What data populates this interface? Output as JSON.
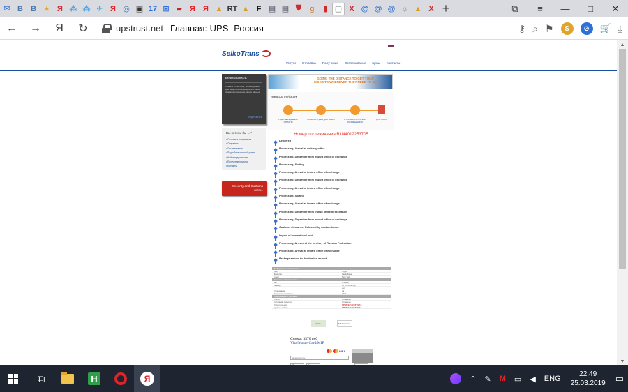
{
  "browser": {
    "tabs": [
      {
        "icon": "mail-icon",
        "glyph": "✉",
        "color": "#2f6fd6"
      },
      {
        "icon": "vk-icon",
        "glyph": "В",
        "color": "#4a76a8"
      },
      {
        "icon": "vk-icon",
        "glyph": "В",
        "color": "#4a76a8"
      },
      {
        "icon": "star-icon",
        "glyph": "★",
        "color": "#e8a628"
      },
      {
        "icon": "yandex-icon",
        "glyph": "Я",
        "color": "#e0222a"
      },
      {
        "icon": "dots-icon",
        "glyph": "⁂",
        "color": "#3c9be0"
      },
      {
        "icon": "dots-icon",
        "glyph": "⁂",
        "color": "#3c9be0"
      },
      {
        "icon": "plane-icon",
        "glyph": "✈",
        "color": "#3c9be0"
      },
      {
        "icon": "yandex-icon",
        "glyph": "Я",
        "color": "#e0222a"
      },
      {
        "icon": "search-icon",
        "glyph": "◎",
        "color": "#3c78c8"
      },
      {
        "icon": "image-icon",
        "glyph": "▣",
        "color": "#333"
      },
      {
        "icon": "calendar-icon",
        "glyph": "17",
        "color": "#2f6fd6"
      },
      {
        "icon": "windows-icon",
        "glyph": "⊞",
        "color": "#2f6fd6"
      },
      {
        "icon": "car-icon",
        "glyph": "▰",
        "color": "#c02828"
      },
      {
        "icon": "yandex-icon",
        "glyph": "Я",
        "color": "#e0222a"
      },
      {
        "icon": "yandex-icon",
        "glyph": "Я",
        "color": "#e0222a"
      },
      {
        "icon": "photo-icon",
        "glyph": "▲",
        "color": "#d9a020"
      },
      {
        "icon": "rt-icon",
        "glyph": "RT",
        "color": "#333"
      },
      {
        "icon": "photo-icon",
        "glyph": "▲",
        "color": "#d9a020"
      },
      {
        "icon": "f-icon",
        "glyph": "F",
        "color": "#111"
      },
      {
        "icon": "doc-icon",
        "glyph": "▤",
        "color": "#556"
      },
      {
        "icon": "doc-icon",
        "glyph": "▤",
        "color": "#556"
      },
      {
        "icon": "shield-icon",
        "glyph": "⛊",
        "color": "#d02a2a"
      },
      {
        "icon": "g-icon",
        "glyph": "g",
        "color": "#d07020"
      },
      {
        "icon": "bookmark-icon",
        "glyph": "▮",
        "color": "#d02a2a"
      },
      {
        "icon": "page-icon",
        "glyph": "▢",
        "color": "#777"
      },
      {
        "icon": "x-icon",
        "glyph": "X",
        "color": "#d02a2a"
      },
      {
        "icon": "mail-at-icon",
        "glyph": "@",
        "color": "#2f6fd6"
      },
      {
        "icon": "mail-at-icon",
        "glyph": "@",
        "color": "#2f6fd6"
      },
      {
        "icon": "mail-at-icon",
        "glyph": "@",
        "color": "#2f6fd6"
      },
      {
        "icon": "sun-icon",
        "glyph": "☼",
        "color": "#777"
      },
      {
        "icon": "photo-icon",
        "glyph": "▲",
        "color": "#d9a020"
      },
      {
        "icon": "x-icon",
        "glyph": "X",
        "color": "#d02a2a"
      }
    ],
    "active_tab_index": 25,
    "domain": "upstrust.net",
    "page_title": "Главная: UPS -Россия"
  },
  "site": {
    "logo_text": "SelkoTrans",
    "nav": [
      "Услуги",
      "Отправка",
      "Получение",
      "Отслеживание",
      "Цены",
      "Контакты"
    ],
    "security": {
      "title": "Безопасность",
      "text": "Узнайте о способах, используемых для защиты информации, и о своих правах в отношении ваших данных",
      "link": "ПОДРОБНЕЕ"
    },
    "help": {
      "title": "Вы хотели бы ...?",
      "items": [
        "• Составить расписание",
        "• Отправить",
        "• Отслеживание",
        "• Подробнее о нашей услуге",
        "• Найти предложение",
        "• Получение посылки",
        "• Контакты"
      ]
    },
    "customs_button": {
      "label": "Security and Customs",
      "sub": "DETAIL ›"
    },
    "banner_text": "GOING THE DISTANCE TO GET YOUR EXHIBITS WHEREVER THEY NEED TO BE",
    "cabinet": {
      "title": "Личный кабинет",
      "steps": [
        "ПОДТВЕРЖДЕНИЕ ОПЛАТЫ",
        "СОЗВОН О ДНЕ ДОСТАВКИ",
        "ОТПРАВКА В СЛУЖБУ РАЗМЕЩЕНИЯ",
        "ДОСТАВКА"
      ]
    },
    "tracking_title": "Номер отслеживания RU44012253705",
    "tracking_events": [
      "Delivered",
      "Processing, Arrival at delivery office",
      "Processing, Departure from inward office of exchange",
      "Processing, Sorting",
      "Processing, Arrival at inward office of exchange",
      "Processing, Departure from inward office of exchange",
      "Processing, Arrival at inward office of exchange",
      "Processing, Sorting",
      "Processing, Arrival at inward office of exchange",
      "Processing, Departure from transit office of exchange",
      "Processing, Departure from inward office of exchange",
      "Customs clearance, Released by custom house",
      "Import of international mail",
      "Processing, Arrived at the territory of Russian Federation",
      "Processing, Arrival at inward office of exchange",
      "Package arrived to destination airport"
    ],
    "details": [
      {
        "type": "head",
        "label": "Информация отправителя"
      },
      {
        "type": "row",
        "label": "Имя",
        "value": "Олди"
      },
      {
        "type": "row",
        "label": "Фамилия",
        "value": "Засвойкина"
      },
      {
        "type": "row",
        "label": "Город",
        "value": "New York"
      },
      {
        "type": "head",
        "label": "Описание отправления"
      },
      {
        "type": "row",
        "label": "Вес",
        "value": "0.360 кг"
      },
      {
        "type": "row",
        "label": "Размер",
        "value": "40*17*20см (ш)"
      },
      {
        "type": "row",
        "label": "",
        "value": "нет"
      },
      {
        "type": "row",
        "label": "Страхование",
        "value": "да"
      },
      {
        "type": "row",
        "label": "Оценочная стоимость",
        "value": "3570"
      },
      {
        "type": "head",
        "label": "Информация о доставке"
      },
      {
        "type": "row",
        "label": "Статус",
        "value": "Оплачено"
      },
      {
        "type": "row",
        "label": "Состояние посылки",
        "value": "Оплачено"
      },
      {
        "type": "row",
        "label": "Услуги курьера",
        "value": "ТРЕБУЕТСЯ ОПЛАТА",
        "red": true
      },
      {
        "type": "row",
        "label": "Сумма к оплате",
        "value": "ТРЕБУЕТСЯ ОПЛАТА",
        "red": true
      }
    ],
    "footer_logos": [
      "Mobile",
      "Mir Payment"
    ],
    "sum_label": "Сумма: 3570 руб",
    "payment_methods": "Visa/MasterCard/MIP",
    "card_placeholder": "Номер карты",
    "card_small_1": "ММ",
    "card_small_2": "ГГ",
    "visa_label": "VISA"
  },
  "taskbar": {
    "language": "ENG",
    "time": "22:49",
    "date": "25.03.2019",
    "h_label": "H",
    "yandex_label": "Я"
  },
  "glyphs": {
    "back": "←",
    "forward": "→",
    "yandex": "Я",
    "refresh": "↻",
    "tab_new": "+",
    "bookmarks": "⧉",
    "menu": "≡",
    "minimize": "—",
    "maximize": "□",
    "close": "✕",
    "key": "⚷",
    "read": "⌕",
    "bookmark": "⚑",
    "ext_1": "S",
    "ext_2": "⊘",
    "cart": "🛒",
    "download": "⤓",
    "scroll_up": "▲",
    "scroll_down": "▼",
    "task_view": "⧉",
    "tray_up": "⌃",
    "tray_notes": "✎",
    "tray_m": "M",
    "tray_net": "▭",
    "tray_vol": "◀",
    "tray_msg": "▭"
  }
}
